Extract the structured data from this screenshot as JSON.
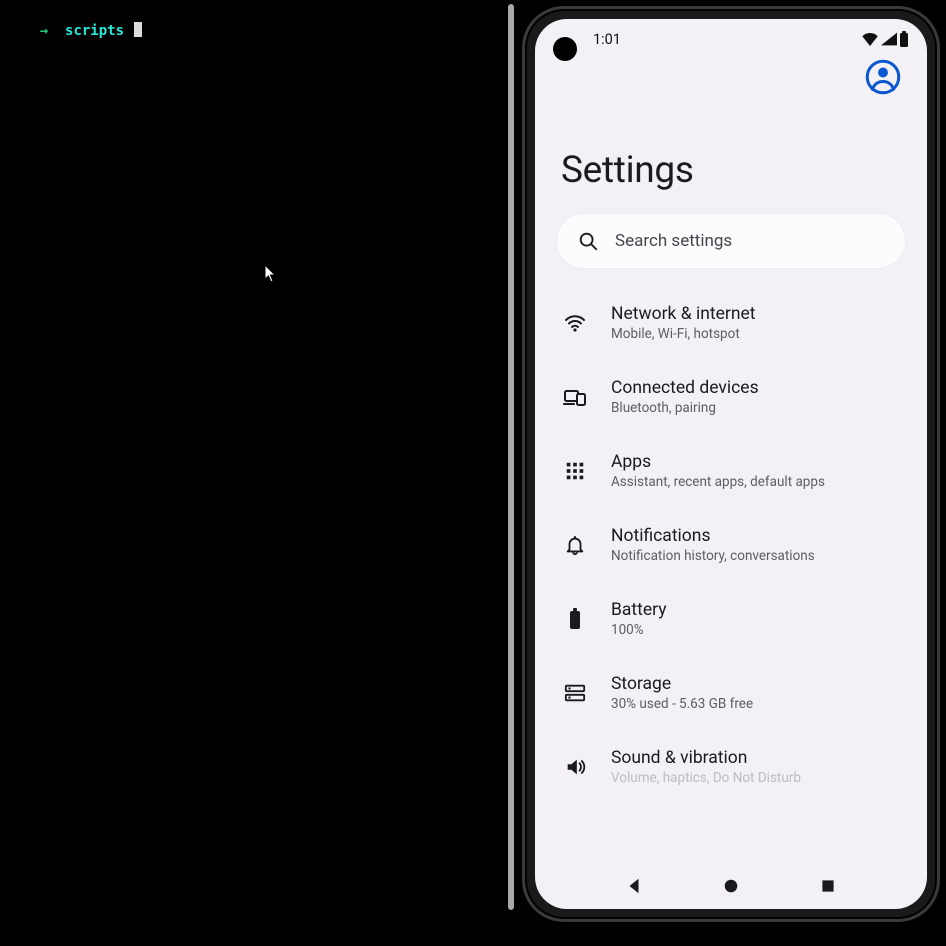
{
  "terminal": {
    "prompt_arrow": "→",
    "prompt_cwd": "scripts"
  },
  "phone": {
    "status": {
      "time": "1:01"
    },
    "header": {
      "title": "Settings"
    },
    "search": {
      "placeholder": "Search settings"
    },
    "items": [
      {
        "label": "Network & internet",
        "sub": "Mobile, Wi-Fi, hotspot"
      },
      {
        "label": "Connected devices",
        "sub": "Bluetooth, pairing"
      },
      {
        "label": "Apps",
        "sub": "Assistant, recent apps, default apps"
      },
      {
        "label": "Notifications",
        "sub": "Notification history, conversations"
      },
      {
        "label": "Battery",
        "sub": "100%"
      },
      {
        "label": "Storage",
        "sub": "30% used - 5.63 GB free"
      },
      {
        "label": "Sound & vibration",
        "sub": "Volume, haptics, Do Not Disturb"
      }
    ]
  }
}
